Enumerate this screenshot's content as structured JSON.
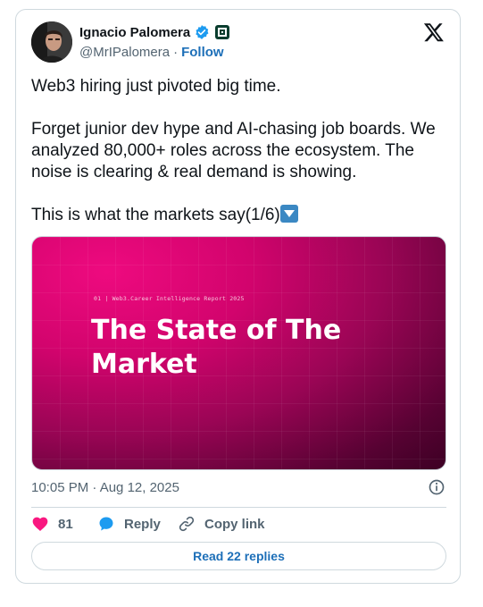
{
  "author": {
    "name": "Ignacio Palomera",
    "handle": "@MrIPalomera",
    "separator": "·",
    "follow_label": "Follow"
  },
  "tweet": {
    "paragraphs": [
      "Web3 hiring just pivoted big time.",
      "Forget junior dev hype and AI-chasing job boards. We analyzed 80,000+ roles across the ecosystem. The noise is clearing & real demand is showing.",
      "This is what the markets say(1/6)"
    ],
    "timestamp": "10:05 PM · Aug 12, 2025"
  },
  "media": {
    "subtitle": "01 | Web3.Career Intelligence Report 2025",
    "title_line1": "The State of The",
    "title_line2": "Market"
  },
  "actions": {
    "likes": "81",
    "reply_label": "Reply",
    "copy_label": "Copy link",
    "read_replies_label": "Read 22 replies"
  },
  "colors": {
    "accent": "#1d9bf0",
    "like": "#f91880",
    "media_pink": "#e3087a",
    "media_dark": "#3d0024"
  },
  "icons": [
    "verified-badge-icon",
    "affiliate-badge-icon",
    "x-logo-icon",
    "down-arrow-emoji-icon",
    "info-icon",
    "heart-icon",
    "reply-bubble-icon",
    "link-icon"
  ]
}
